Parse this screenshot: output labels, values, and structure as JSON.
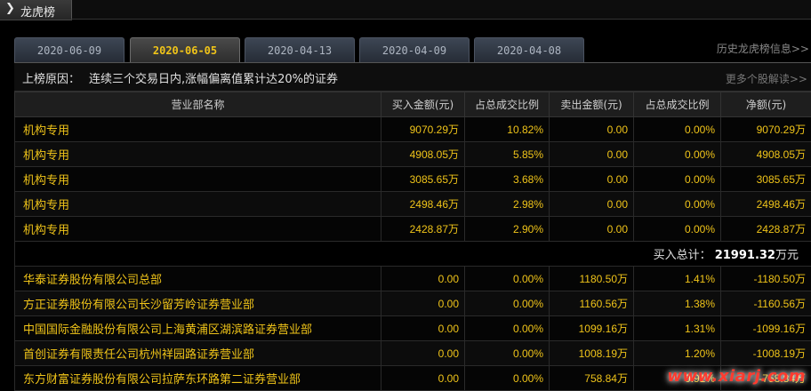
{
  "header": {
    "title": "龙虎榜",
    "arrow": "❯"
  },
  "tabs": [
    {
      "label": "2020-06-09",
      "active": false
    },
    {
      "label": "2020-06-05",
      "active": true
    },
    {
      "label": "2020-04-13",
      "active": false
    },
    {
      "label": "2020-04-09",
      "active": false
    },
    {
      "label": "2020-04-08",
      "active": false
    }
  ],
  "history_link": "历史龙虎榜信息>>",
  "reason": {
    "label": "上榜原因：",
    "value": "连续三个交易日内,涨幅偏离值累计达20%的证券",
    "more_link": "更多个股解读>>"
  },
  "table": {
    "columns": [
      "营业部名称",
      "买入金额(元)",
      "占总成交比例",
      "卖出金额(元)",
      "占总成交比例",
      "净额(元)"
    ],
    "buy_rows": [
      [
        "机构专用",
        "9070.29万",
        "10.82%",
        "0.00",
        "0.00%",
        "9070.29万"
      ],
      [
        "机构专用",
        "4908.05万",
        "5.85%",
        "0.00",
        "0.00%",
        "4908.05万"
      ],
      [
        "机构专用",
        "3085.65万",
        "3.68%",
        "0.00",
        "0.00%",
        "3085.65万"
      ],
      [
        "机构专用",
        "2498.46万",
        "2.98%",
        "0.00",
        "0.00%",
        "2498.46万"
      ],
      [
        "机构专用",
        "2428.87万",
        "2.90%",
        "0.00",
        "0.00%",
        "2428.87万"
      ]
    ],
    "buy_total": {
      "label": "买入总计：",
      "value": "21991.32",
      "unit": "万元"
    },
    "sell_rows": [
      [
        "华泰证券股份有限公司总部",
        "0.00",
        "0.00%",
        "1180.50万",
        "1.41%",
        "-1180.50万"
      ],
      [
        "方正证券股份有限公司长沙留芳岭证券营业部",
        "0.00",
        "0.00%",
        "1160.56万",
        "1.38%",
        "-1160.56万"
      ],
      [
        "中国国际金融股份有限公司上海黄浦区湖滨路证券营业部",
        "0.00",
        "0.00%",
        "1099.16万",
        "1.31%",
        "-1099.16万"
      ],
      [
        "首创证券有限责任公司杭州祥园路证券营业部",
        "0.00",
        "0.00%",
        "1008.19万",
        "1.20%",
        "-1008.19万"
      ],
      [
        "东方财富证券股份有限公司拉萨东环路第二证券营业部",
        "0.00",
        "0.00%",
        "758.84万",
        "0.91%",
        "-758.84万"
      ]
    ]
  },
  "watermark": "www.xiarj.com",
  "colors": {
    "accent": "#f0c419",
    "background": "#000000",
    "watermark": "#ff3b2f"
  }
}
